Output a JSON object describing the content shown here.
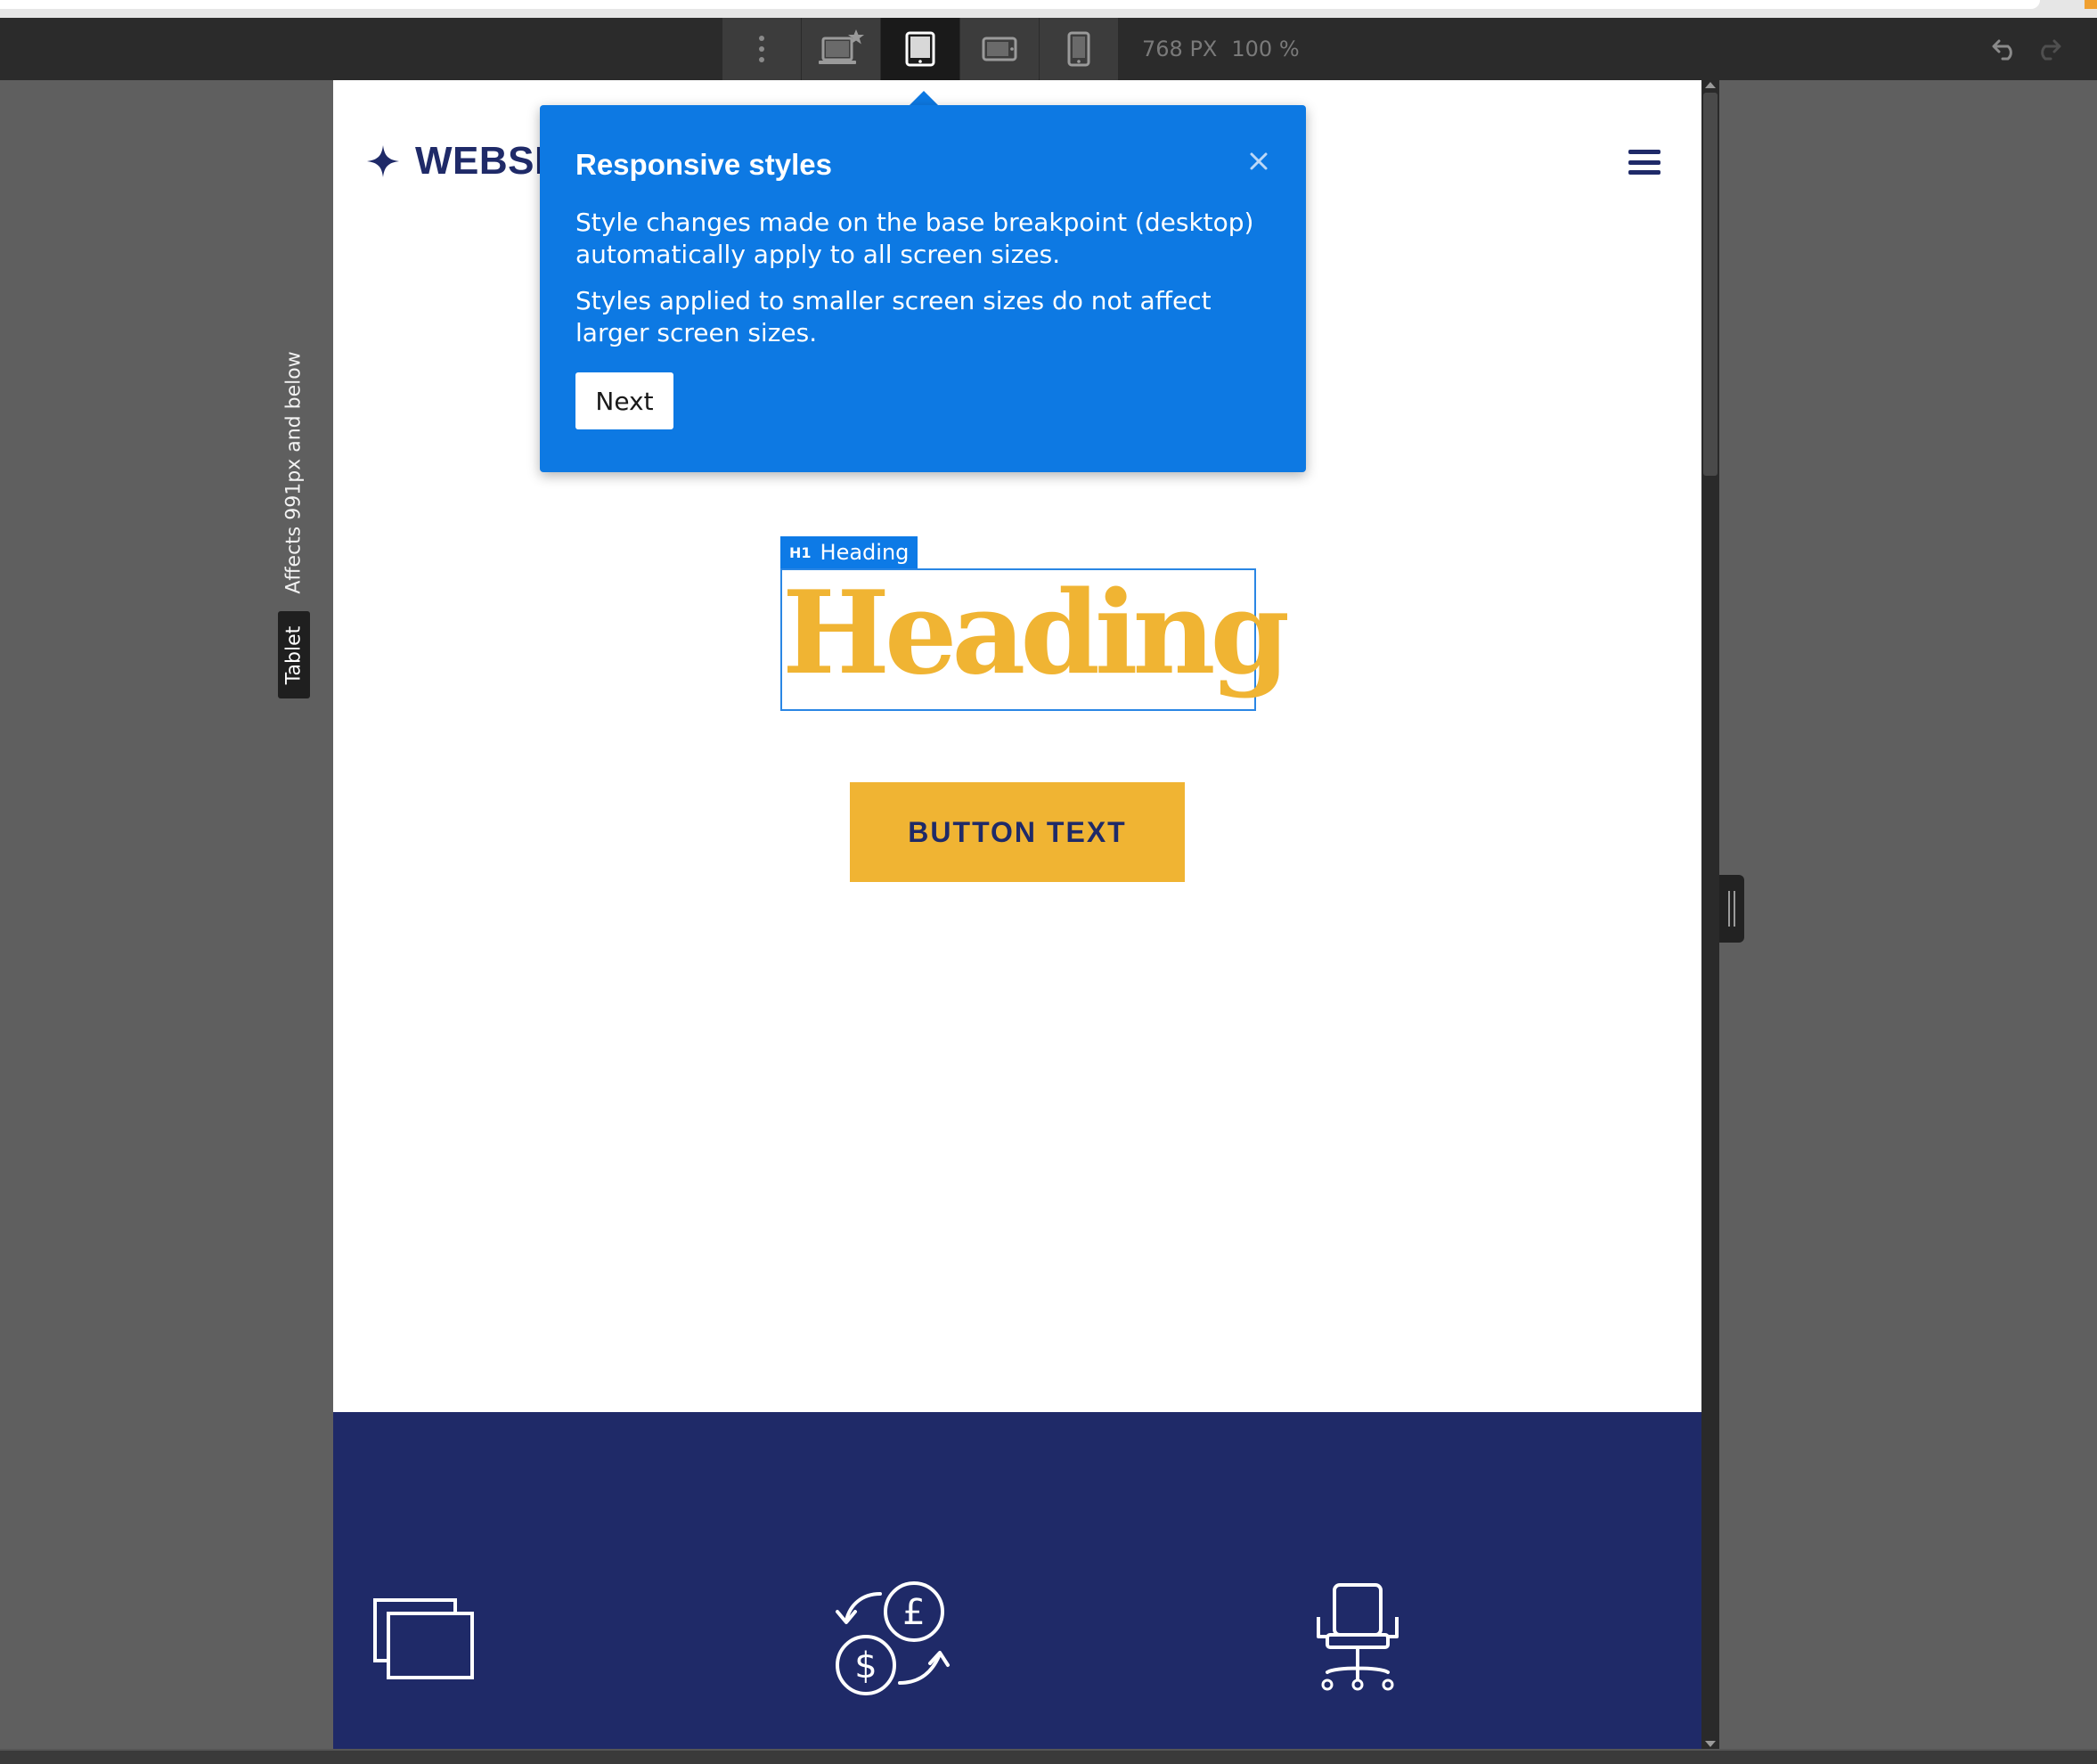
{
  "toolbar": {
    "viewport_width": "768",
    "viewport_unit": "PX",
    "zoom_value": "100",
    "zoom_unit": "%",
    "buttons": [
      {
        "icon": "vertical-dots-icon",
        "active": false
      },
      {
        "icon": "laptop-star-icon",
        "active": false
      },
      {
        "icon": "tablet-icon",
        "active": true
      },
      {
        "icon": "mobile-landscape-icon",
        "active": false
      },
      {
        "icon": "mobile-portrait-icon",
        "active": false
      }
    ],
    "history": {
      "undo_icon": "undo-icon",
      "redo_icon": "redo-icon"
    }
  },
  "breakpoint": {
    "affects_text": "Affects 991px and below",
    "name": "Tablet"
  },
  "site": {
    "logo_icon": "sparkle-icon",
    "logo_text": "WEBSIT",
    "menu_icon": "hamburger-icon",
    "heading_tag_level": "H1",
    "heading_tag_label": "Heading",
    "heading_text": "Heading",
    "button_text": "BUTTON TEXT",
    "feature_icons": [
      "stacked-windows-icon",
      "currency-exchange-icon",
      "office-chair-icon"
    ]
  },
  "popover": {
    "title": "Responsive styles",
    "paragraph_1": "Style changes made on the base breakpoint (desktop) automatically apply to all screen sizes.",
    "paragraph_2": "Styles applied to smaller screen sizes do not affect larger screen sizes.",
    "next_label": "Next",
    "close_icon": "close-icon"
  },
  "colors": {
    "popover_blue": "#0d79e3",
    "brand_navy": "#1f2a68",
    "accent_gold": "#f0b433",
    "toolbar_dark": "#2b2b2b",
    "editor_gray": "#5f5f5f"
  }
}
